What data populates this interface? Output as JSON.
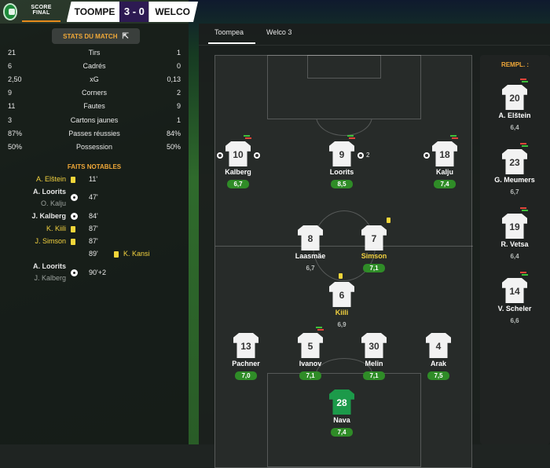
{
  "header": {
    "score_final_label": "SCORE FINAL",
    "home_team": "TOOMPE",
    "score": "3 - 0",
    "away_team": "WELCO"
  },
  "stats": {
    "button_label": "STATS DU MATCH",
    "rows": [
      {
        "home": "21",
        "label": "Tirs",
        "away": "1"
      },
      {
        "home": "6",
        "label": "Cadrés",
        "away": "0"
      },
      {
        "home": "2,50",
        "label": "xG",
        "away": "0,13"
      },
      {
        "home": "9",
        "label": "Corners",
        "away": "2"
      },
      {
        "home": "11",
        "label": "Fautes",
        "away": "9"
      },
      {
        "home": "3",
        "label": "Cartons jaunes",
        "away": "1"
      },
      {
        "home": "87%",
        "label": "Passes réussies",
        "away": "84%"
      },
      {
        "home": "50%",
        "label": "Possession",
        "away": "50%"
      }
    ]
  },
  "events": {
    "title": "FAITS NOTABLES",
    "items": [
      {
        "name": "A. Elštein",
        "type": "yellow-card",
        "time": "11'"
      },
      {
        "name": "A. Loorits",
        "assist": "O. Kalju",
        "type": "goal",
        "time": "47'"
      },
      {
        "name": "J. Kalberg",
        "type": "goal",
        "time": "84'"
      },
      {
        "name": "K. Kiili",
        "type": "yellow-card",
        "time": "87'"
      },
      {
        "name": "J. Simson",
        "type": "yellow-card",
        "time": "87'"
      },
      {
        "away_name": "K. Kansi",
        "type": "yellow-card",
        "time": "89'"
      },
      {
        "name": "A. Loorits",
        "assist": "J. Kalberg",
        "type": "goal",
        "time": "90'+2"
      }
    ]
  },
  "tabs": {
    "home": "Toompea",
    "away": "Welco 3"
  },
  "lineup": {
    "players": [
      {
        "number": "10",
        "name": "Kalberg",
        "rating": "6,7"
      },
      {
        "number": "9",
        "name": "Loorits",
        "rating": "8,5",
        "goals": "2"
      },
      {
        "number": "18",
        "name": "Kalju",
        "rating": "7,4"
      },
      {
        "number": "8",
        "name": "Laasmäe",
        "rating": "6,7"
      },
      {
        "number": "7",
        "name": "Simson",
        "rating": "7,1"
      },
      {
        "number": "6",
        "name": "Kiili",
        "rating": "6,9"
      },
      {
        "number": "13",
        "name": "Pachner",
        "rating": "7,0"
      },
      {
        "number": "5",
        "name": "Ivanov",
        "rating": "7,1"
      },
      {
        "number": "30",
        "name": "Melin",
        "rating": "7,1"
      },
      {
        "number": "4",
        "name": "Arak",
        "rating": "7,5"
      },
      {
        "number": "28",
        "name": "Nava",
        "rating": "7,4"
      }
    ]
  },
  "subs": {
    "title": "REMPL. :",
    "players": [
      {
        "number": "20",
        "name": "A. Elštein",
        "rating": "6,4"
      },
      {
        "number": "23",
        "name": "G. Meumers",
        "rating": "6,7"
      },
      {
        "number": "19",
        "name": "R. Vetsa",
        "rating": "6,4"
      },
      {
        "number": "14",
        "name": "V. Scheler",
        "rating": "6,6"
      }
    ]
  },
  "colors": {
    "accent": "#f0a838",
    "rating_green": "#2f8c27",
    "card_yellow": "#f3d63a",
    "score_bg": "#2d1a52"
  }
}
